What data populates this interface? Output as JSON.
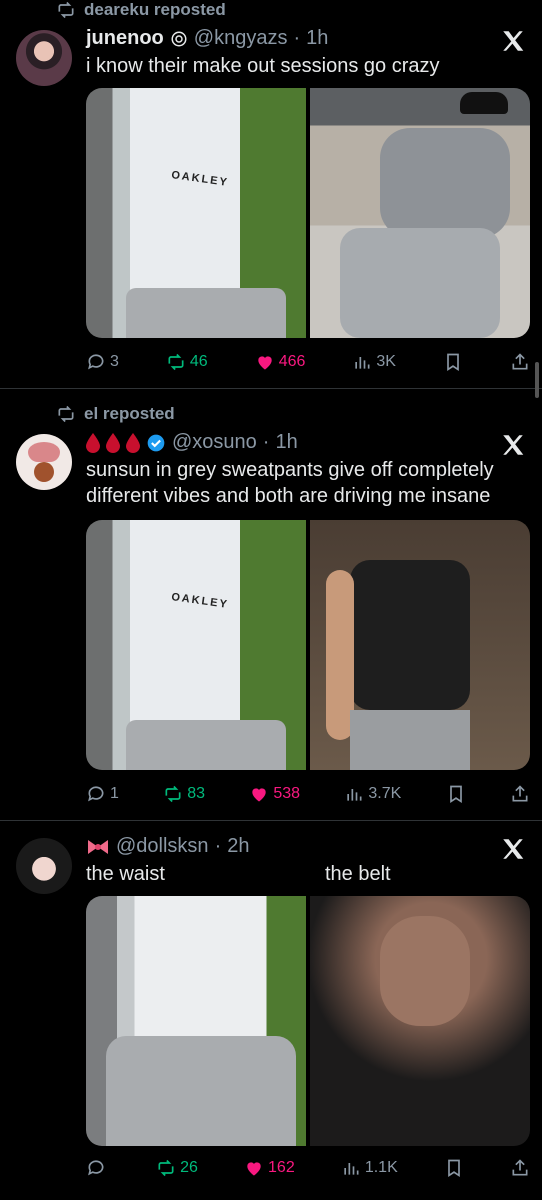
{
  "tweets": [
    {
      "repost_by": "deareku reposted",
      "name": "junenoo",
      "handle": "@kngyazs",
      "time": "1h",
      "text": "i know their make out sessions go crazy",
      "replies": "3",
      "reposts": "46",
      "likes": "466",
      "views": "3K"
    },
    {
      "repost_by": "el reposted",
      "name": "",
      "handle": "@xosuno",
      "time": "1h",
      "text": "sunsun in grey sweatpants give off completely different vibes and both are driving me insane",
      "replies": "1",
      "reposts": "83",
      "likes": "538",
      "views": "3.7K"
    },
    {
      "name": "",
      "handle": "@dollsksn",
      "time": "2h",
      "text_left": "the waist",
      "text_right": "the belt",
      "replies": "",
      "reposts": "26",
      "likes": "162",
      "views": "1.1K"
    }
  ],
  "image_text": {
    "brand": "OAKLEY"
  },
  "colors": {
    "background": "#000000",
    "text": "#e7e9ea",
    "muted": "#8b98a5",
    "repost": "#00ba7c",
    "like": "#f91880",
    "verified": "#1d9bf0"
  }
}
